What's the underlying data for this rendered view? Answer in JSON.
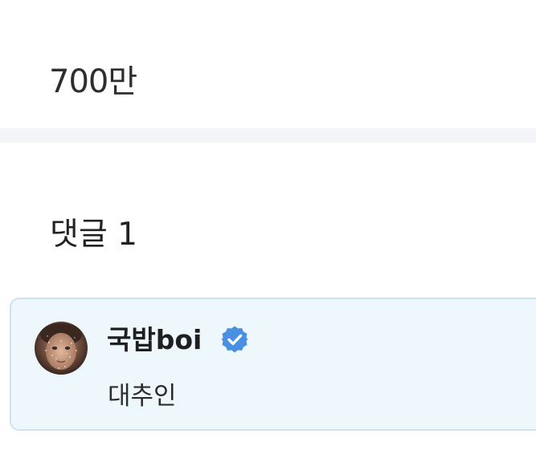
{
  "stats": {
    "count": "700만"
  },
  "comments": {
    "header": "댓글 1",
    "items": [
      {
        "author": "국밥boi",
        "verified": true,
        "text": "대추인",
        "avatar_icon": "user-avatar-photo",
        "badge_icon": "verified-badge-icon",
        "badge_color": "#4a90e2"
      }
    ]
  },
  "colors": {
    "divider": "#f4f5f8",
    "card_background": "#eef7fc",
    "card_border": "#cfe3ee"
  }
}
